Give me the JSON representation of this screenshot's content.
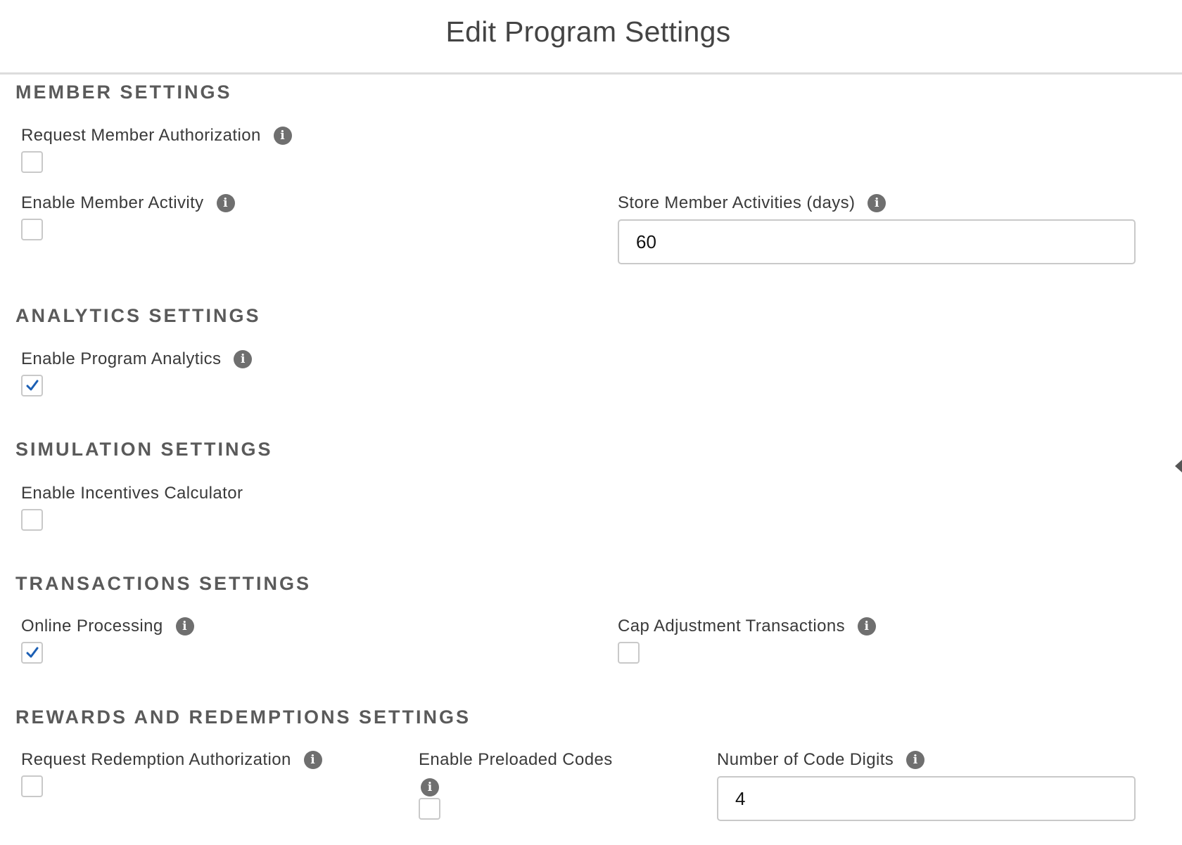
{
  "modal": {
    "title": "Edit Program Settings"
  },
  "sections": {
    "member": {
      "title": "MEMBER SETTINGS",
      "request_member_authorization": {
        "label": "Request Member Authorization",
        "checked": false
      },
      "enable_member_activity": {
        "label": "Enable Member Activity",
        "checked": false
      },
      "store_member_activities": {
        "label": "Store Member Activities (days)",
        "value": "60"
      }
    },
    "analytics": {
      "title": "ANALYTICS SETTINGS",
      "enable_program_analytics": {
        "label": "Enable Program Analytics",
        "checked": true
      }
    },
    "simulation": {
      "title": "SIMULATION SETTINGS",
      "enable_incentives_calculator": {
        "label": "Enable Incentives Calculator",
        "checked": false
      }
    },
    "transactions": {
      "title": "TRANSACTIONS SETTINGS",
      "online_processing": {
        "label": "Online Processing",
        "checked": true
      },
      "cap_adjustment_transactions": {
        "label": "Cap Adjustment Transactions",
        "checked": false
      }
    },
    "rewards": {
      "title": "REWARDS AND REDEMPTIONS SETTINGS",
      "request_redemption_authorization": {
        "label": "Request Redemption Authorization",
        "checked": false
      },
      "enable_preloaded_codes": {
        "label": "Enable Preloaded Codes",
        "checked": false
      },
      "number_of_code_digits": {
        "label": "Number of Code Digits",
        "value": "4"
      }
    }
  },
  "colors": {
    "check_mark": "#1b5fb4",
    "info_icon": "#6f6f6f",
    "border": "#c9c9c9"
  }
}
